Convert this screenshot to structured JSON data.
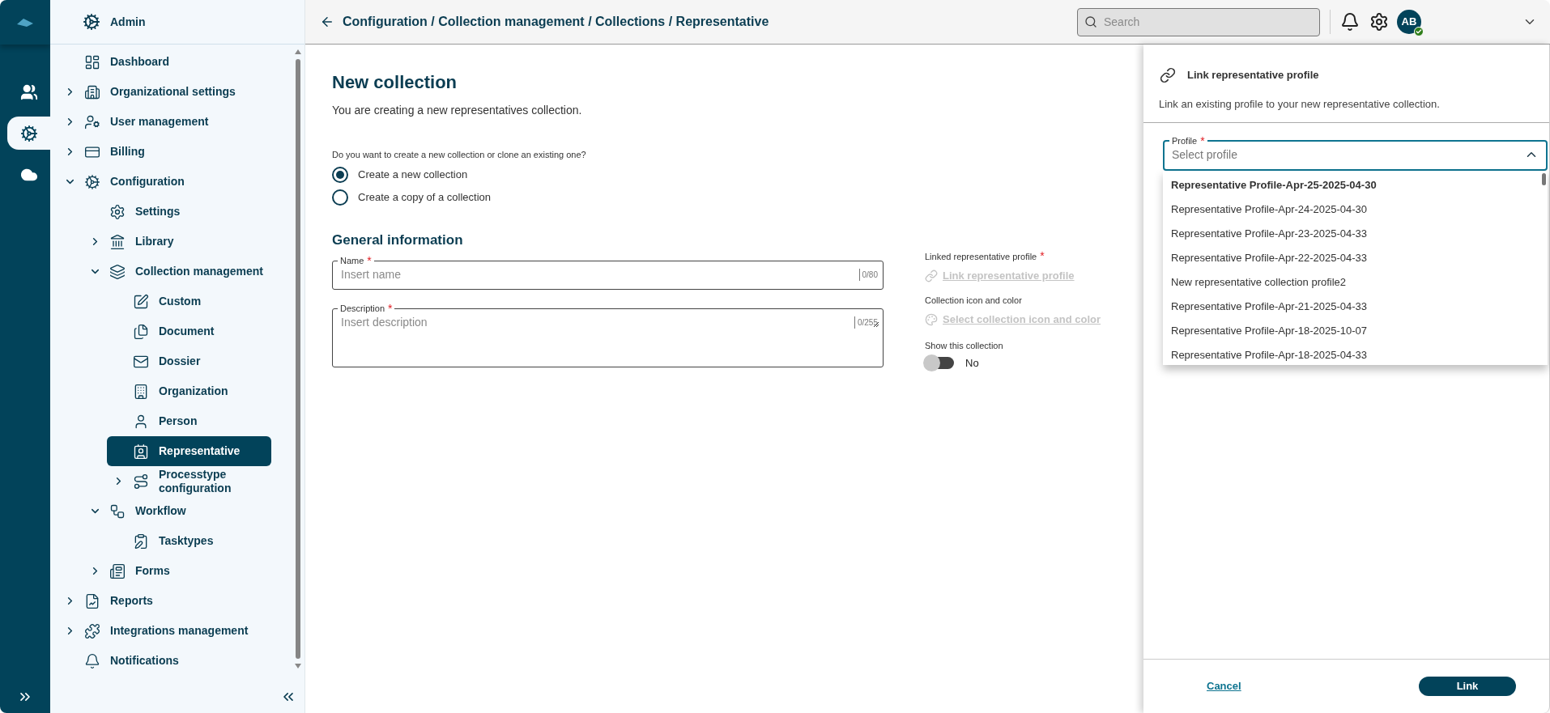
{
  "rail": {
    "items": [
      {
        "selected": false
      },
      {
        "selected": true
      },
      {
        "selected": false
      }
    ]
  },
  "sidebar": {
    "title": "Admin",
    "items": [
      {
        "label": "Dashboard",
        "selected": false
      },
      {
        "label": "Organizational settings",
        "expanded": false,
        "selected": false
      },
      {
        "label": "User management",
        "expanded": false,
        "selected": false
      },
      {
        "label": "Billing",
        "expanded": false,
        "selected": false
      },
      {
        "label": "Configuration",
        "expanded": true,
        "selected": false,
        "children": [
          {
            "label": "Settings",
            "selected": false
          },
          {
            "label": "Library",
            "expanded": false,
            "selected": false
          },
          {
            "label": "Collection management",
            "expanded": true,
            "selected": false,
            "children": [
              {
                "label": "Custom",
                "selected": false
              },
              {
                "label": "Document",
                "selected": false
              },
              {
                "label": "Dossier",
                "selected": false
              },
              {
                "label": "Organization",
                "selected": false
              },
              {
                "label": "Person",
                "selected": false
              },
              {
                "label": "Representative",
                "selected": true
              },
              {
                "label": "Processtype configuration",
                "expanded": false,
                "selected": false
              }
            ]
          },
          {
            "label": "Workflow",
            "expanded": true,
            "selected": false,
            "children": [
              {
                "label": "Tasktypes",
                "selected": false
              }
            ]
          },
          {
            "label": "Forms",
            "expanded": false,
            "selected": false
          }
        ]
      },
      {
        "label": "Reports",
        "expanded": false,
        "selected": false
      },
      {
        "label": "Integrations management",
        "expanded": false,
        "selected": false
      },
      {
        "label": "Notifications",
        "selected": false
      }
    ]
  },
  "header": {
    "breadcrumb": "Configuration / Collection management / Collections / Representative",
    "search": {
      "placeholder": "Search"
    },
    "avatar": {
      "initials": "AB",
      "online": true
    }
  },
  "form": {
    "title": "New collection",
    "subtitle": "You are creating a new representatives collection.",
    "question": "Do you want to create a new collection or clone an existing one?",
    "options": [
      {
        "label": "Create a new collection",
        "selected": true
      },
      {
        "label": "Create a copy of a collection",
        "selected": false
      }
    ],
    "section": "General information",
    "fields": [
      {
        "kind": "input",
        "label": "Name",
        "required_mark": "*",
        "placeholder": "Insert name",
        "counter": "0/80"
      },
      {
        "kind": "textarea",
        "label": "Description",
        "required_mark": "*",
        "placeholder": "Insert description",
        "counter": "0/255"
      }
    ],
    "side": [
      {
        "kind": "link",
        "label": "Linked representative profile",
        "required_mark": "*",
        "link": "Link representative profile",
        "disabled": true
      },
      {
        "kind": "link",
        "label": "Collection icon and color",
        "link": "Select collection icon and color",
        "disabled": true
      },
      {
        "kind": "toggle",
        "label": "Show this collection",
        "on": false,
        "value": "No"
      }
    ]
  },
  "panel": {
    "title": "Link representative profile",
    "description": "Link an existing profile to your new representative collection.",
    "select": {
      "label": "Profile",
      "required_mark": "*",
      "placeholder": "Select profile",
      "expanded": true,
      "options": [
        {
          "label": "Representative Profile-Apr-25-2025-04-30",
          "focused": true
        },
        {
          "label": "Representative Profile-Apr-24-2025-04-30",
          "focused": false
        },
        {
          "label": "Representative Profile-Apr-23-2025-04-33",
          "focused": false
        },
        {
          "label": "Representative Profile-Apr-22-2025-04-33",
          "focused": false
        },
        {
          "label": "New representative collection profile2",
          "focused": false
        },
        {
          "label": "Representative Profile-Apr-21-2025-04-33",
          "focused": false
        },
        {
          "label": "Representative Profile-Apr-18-2025-10-07",
          "focused": false
        },
        {
          "label": "Representative Profile-Apr-18-2025-04-33",
          "focused": false
        }
      ]
    },
    "cancel": "Cancel",
    "confirm": "Link"
  }
}
